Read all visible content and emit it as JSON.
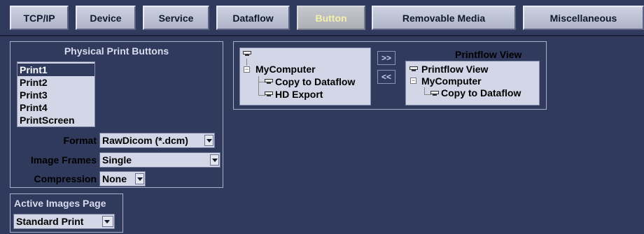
{
  "tabs": [
    {
      "label": "TCP/IP"
    },
    {
      "label": "Device"
    },
    {
      "label": "Service"
    },
    {
      "label": "Dataflow"
    },
    {
      "label": "Button"
    },
    {
      "label": "Removable Media"
    },
    {
      "label": "Miscellaneous"
    }
  ],
  "active_tab": "Button",
  "physical_print_buttons": {
    "title": "Physical Print Buttons",
    "items": [
      "Print1",
      "Print2",
      "Print3",
      "Print4",
      "PrintScreen"
    ],
    "selected": "Print1",
    "format_label": "Format",
    "format_value": "RawDicom (*.dcm)",
    "image_frames_label": "Image Frames",
    "image_frames_value": "Single",
    "compression_label": "Compression",
    "compression_value": "None"
  },
  "active_images_page": {
    "title": "Active Images Page",
    "value": "Standard Print"
  },
  "available_tree": {
    "root": "MyComputer",
    "children": [
      "Copy to Dataflow",
      "HD Export"
    ]
  },
  "move_buttons": {
    "add": ">>",
    "remove": "<<"
  },
  "printflow": {
    "title": "Printflow View",
    "root": "Printflow View",
    "child": "MyComputer",
    "grandchild": "Copy to Dataflow"
  },
  "colors": {
    "background": "#2f3a5c",
    "active_tab_text": "#f4f0a8",
    "list_background": "#d2d6e6"
  }
}
